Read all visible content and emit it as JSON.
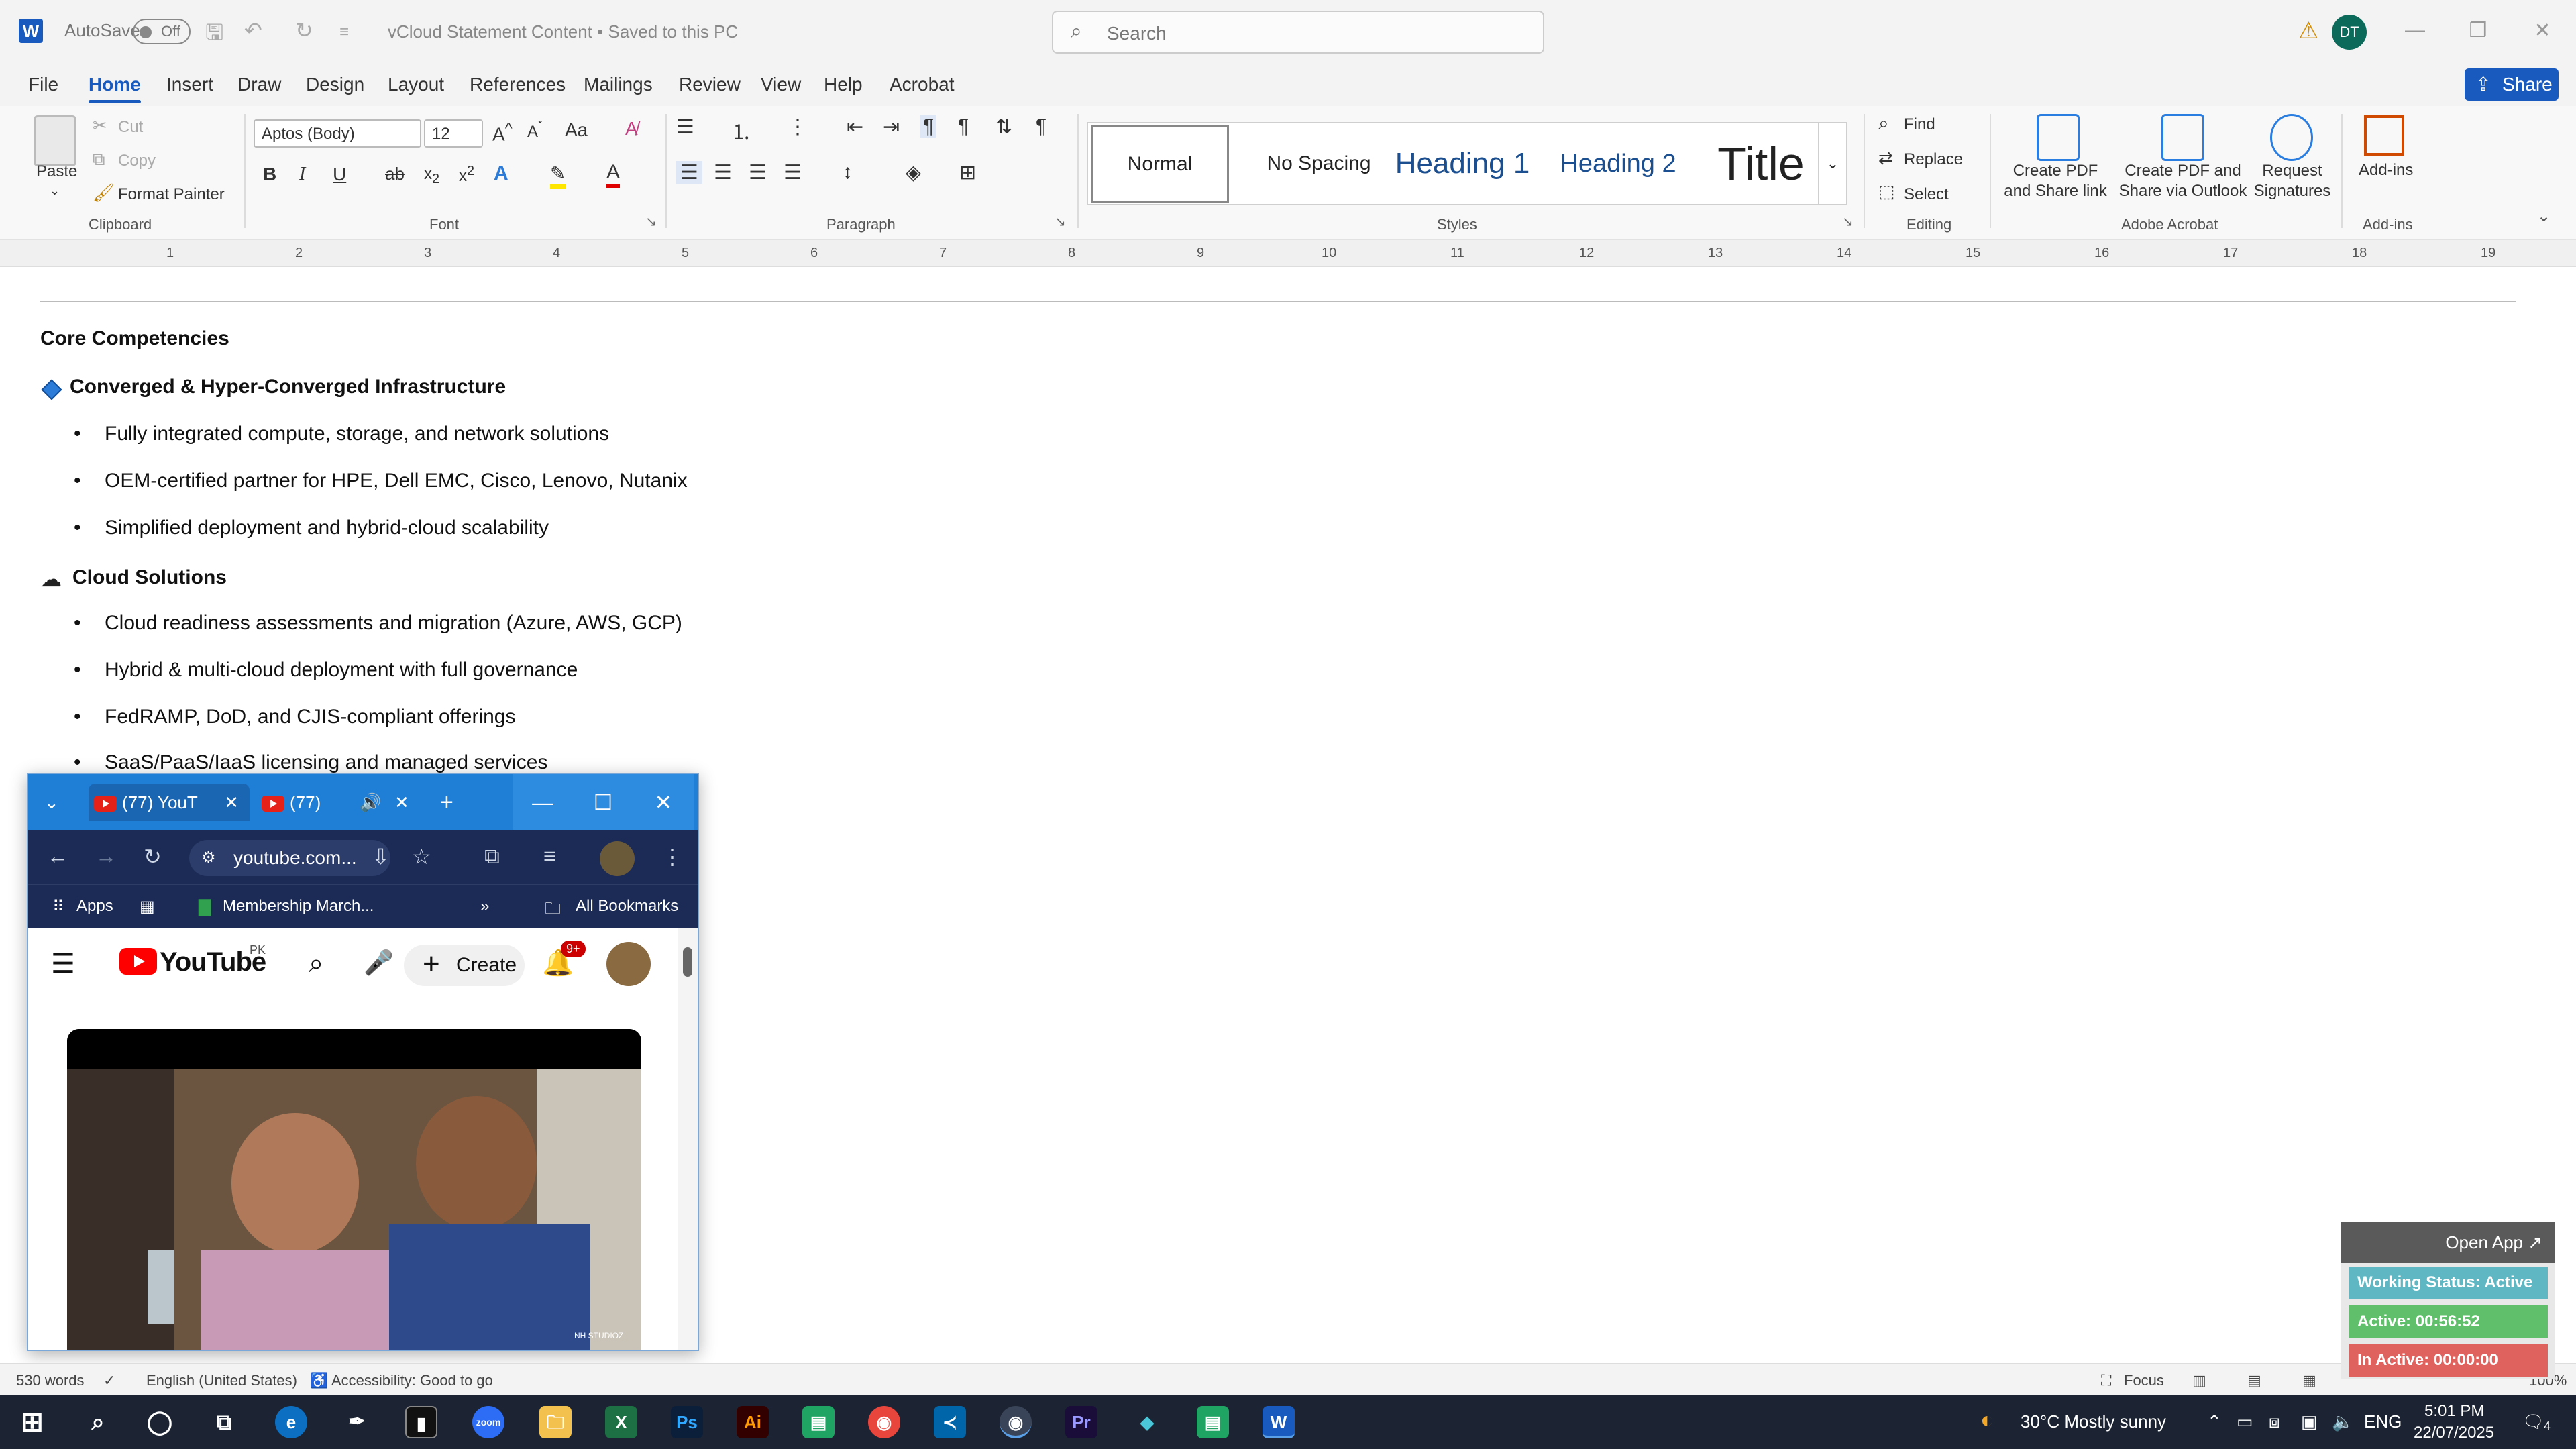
{
  "titlebar": {
    "app_icon": "W",
    "autosave_label": "AutoSave",
    "autosave_state": "Off",
    "document_title": "vCloud Statement Content • Saved to this PC",
    "search_placeholder": "Search",
    "user_initials": "DT"
  },
  "menu": {
    "items": [
      "File",
      "Home",
      "Insert",
      "Draw",
      "Design",
      "Layout",
      "References",
      "Mailings",
      "Review",
      "View",
      "Help",
      "Acrobat"
    ],
    "active": "Home",
    "share_label": "Share"
  },
  "ribbon": {
    "clipboard": {
      "paste": "Paste",
      "cut": "Cut",
      "copy": "Copy",
      "format_painter": "Format Painter",
      "label": "Clipboard"
    },
    "font": {
      "name": "Aptos (Body)",
      "size": "12",
      "label": "Font"
    },
    "paragraph": {
      "label": "Paragraph"
    },
    "styles": {
      "items": [
        "Normal",
        "No Spacing",
        "Heading 1",
        "Heading 2",
        "Title"
      ],
      "label": "Styles"
    },
    "editing": {
      "find": "Find",
      "replace": "Replace",
      "select": "Select",
      "label": "Editing"
    },
    "acrobat": {
      "create_pdf": "Create PDF and Share link",
      "create_pdf_outlook": "Create PDF and Share via Outlook",
      "request_signatures": "Request Signatures",
      "label": "Adobe Acrobat"
    },
    "addins": {
      "button": "Add-ins",
      "label": "Add-ins"
    }
  },
  "ruler": {
    "numbers": [
      "1",
      "2",
      "3",
      "4",
      "5",
      "6",
      "7",
      "8",
      "9",
      "10",
      "11",
      "12",
      "13",
      "14",
      "15",
      "16",
      "17",
      "18",
      "19"
    ]
  },
  "document": {
    "heading": "Core Competencies",
    "section1": {
      "title": "Converged & Hyper-Converged Infrastructure",
      "bullets": [
        "Fully integrated compute, storage, and network solutions",
        "OEM-certified partner for HPE, Dell EMC, Cisco, Lenovo, Nutanix",
        "Simplified deployment and hybrid-cloud scalability"
      ]
    },
    "section2": {
      "title": "Cloud Solutions",
      "bullets": [
        "Cloud readiness assessments and migration (Azure, AWS, GCP)",
        "Hybrid & multi-cloud deployment with full governance",
        "FedRAMP, DoD, and CJIS-compliant offerings",
        "SaaS/PaaS/IaaS licensing and managed services"
      ]
    }
  },
  "chrome": {
    "tabs": [
      "(77) YouT",
      "(77)"
    ],
    "url": "youtube.com...",
    "bookmarks": {
      "apps": "Apps",
      "membership": "Membership March...",
      "all": "All Bookmarks"
    },
    "youtube": {
      "logo": "YouTube",
      "region": "PK",
      "create": "Create",
      "notifications": "9+",
      "watermark": "NH STUDIOZ"
    }
  },
  "statusbar": {
    "words": "530 words",
    "language": "English (United States)",
    "accessibility": "Accessibility: Good to go",
    "focus": "Focus",
    "zoom": "100%"
  },
  "tracker": {
    "open_app": "Open App ↗",
    "working_status": "Working Status: Active",
    "active": "Active: 00:56:52",
    "inactive": "In Active: 00:00:00",
    "colors": {
      "status": "#5fb7c3",
      "active": "#5fbf6a",
      "inactive": "#e0625e"
    }
  },
  "taskbar": {
    "weather": "30°C  Mostly sunny",
    "lang": "ENG",
    "time": "5:01 PM",
    "date": "22/07/2025",
    "notifications": "4"
  }
}
